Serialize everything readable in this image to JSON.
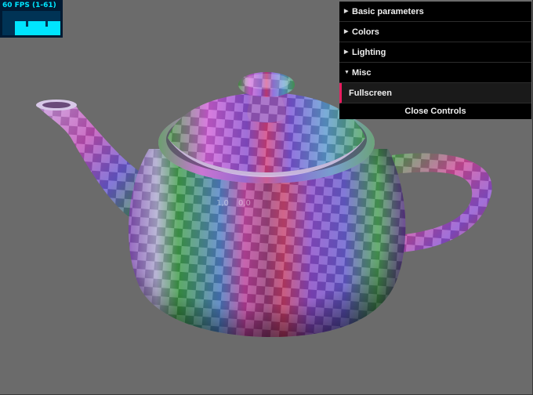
{
  "stats": {
    "fps_label": "60 FPS (1-61)"
  },
  "gui": {
    "folders": [
      {
        "label": "Basic parameters",
        "state": "collapsed"
      },
      {
        "label": "Colors",
        "state": "collapsed"
      },
      {
        "label": "Lighting",
        "state": "collapsed"
      },
      {
        "label": "Misc",
        "state": "expanded"
      }
    ],
    "misc_items": [
      {
        "label": "Fullscreen"
      }
    ],
    "close_label": "Close Controls",
    "accent_color": "#e61d5f"
  },
  "scene": {
    "background": "#6b6b6b",
    "uv_labels": [
      "1,0",
      "0,0"
    ]
  }
}
